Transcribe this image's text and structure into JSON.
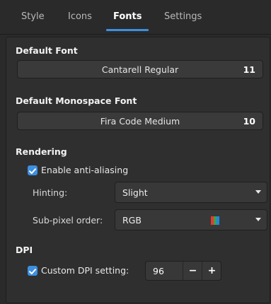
{
  "tabs": [
    {
      "label": "Style",
      "active": false
    },
    {
      "label": "Icons",
      "active": false
    },
    {
      "label": "Fonts",
      "active": true
    },
    {
      "label": "Settings",
      "active": false
    }
  ],
  "accent_color": "#3d8fe0",
  "default_font": {
    "title": "Default Font",
    "name": "Cantarell Regular",
    "size": "11"
  },
  "mono_font": {
    "title": "Default Monospace Font",
    "name": "Fira Code Medium",
    "size": "10"
  },
  "rendering": {
    "title": "Rendering",
    "antialias_label": "Enable anti-aliasing",
    "antialias_checked": true,
    "hinting_label": "Hinting:",
    "hinting_value": "Slight",
    "subpixel_label": "Sub-pixel order:",
    "subpixel_value": "RGB",
    "subpixel_icon": "rgb-stripes-icon"
  },
  "dpi": {
    "title": "DPI",
    "custom_label": "Custom DPI setting:",
    "custom_checked": true,
    "value": "96",
    "decrement_label": "−",
    "increment_label": "+"
  }
}
